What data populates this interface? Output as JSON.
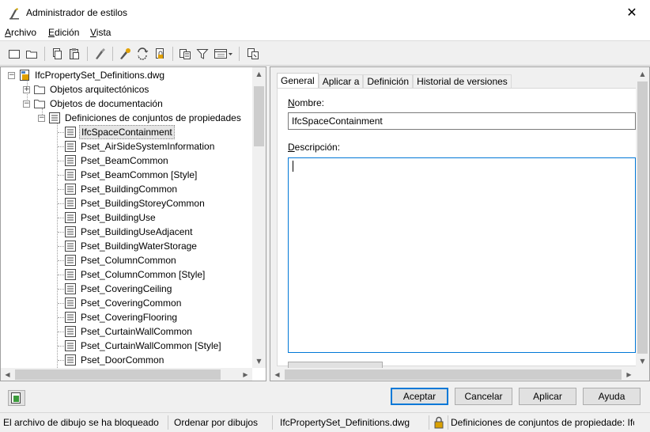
{
  "window": {
    "title": "Administrador de estilos",
    "close_glyph": "✕"
  },
  "menu": [
    {
      "label": "Archivo"
    },
    {
      "label": "Edición"
    },
    {
      "label": "Vista"
    }
  ],
  "toolbar": {
    "buttons": [
      "new-icon",
      "open-icon",
      "copy-icon",
      "paste-icon",
      "purge-icon",
      "edit-style-icon",
      "sync-icon",
      "lock-icon",
      "view-icon",
      "filter-icon",
      "display-icon",
      "help-icon"
    ]
  },
  "tree": {
    "root": "IfcPropertySet_Definitions.dwg",
    "folder1": "Objetos arquitectónicos",
    "folder2": "Objetos de documentación",
    "category": "Definiciones de conjuntos de propiedades",
    "items": [
      "IfcSpaceContainment",
      "Pset_AirSideSystemInformation",
      "Pset_BeamCommon",
      "Pset_BeamCommon [Style]",
      "Pset_BuildingCommon",
      "Pset_BuildingStoreyCommon",
      "Pset_BuildingUse",
      "Pset_BuildingUseAdjacent",
      "Pset_BuildingWaterStorage",
      "Pset_ColumnCommon",
      "Pset_ColumnCommon [Style]",
      "Pset_CoveringCeiling",
      "Pset_CoveringCommon",
      "Pset_CoveringFlooring",
      "Pset_CurtainWallCommon",
      "Pset_CurtainWallCommon [Style]",
      "Pset_DoorCommon"
    ],
    "expanded_glyph": "−",
    "collapsed_glyph": "+"
  },
  "tabs": [
    {
      "label": "General"
    },
    {
      "label": "Aplicar a"
    },
    {
      "label": "Definición"
    },
    {
      "label": "Historial de versiones"
    }
  ],
  "general": {
    "name_label": "Nombre:",
    "name_value": "IfcSpaceContainment",
    "desc_label": "Descripción:",
    "desc_value": ""
  },
  "buttons": {
    "accept": "Aceptar",
    "cancel": "Cancelar",
    "apply": "Aplicar",
    "help": "Ayuda"
  },
  "status": {
    "lock_msg": "El archivo de dibujo se ha bloqueado",
    "sort": "Ordenar por dibujos",
    "file": "IfcPropertySet_Definitions.dwg",
    "path": "Definiciones de conjuntos de propiedade: IfcSpaceContainment"
  },
  "arrows": {
    "up": "▲",
    "down": "▼",
    "left": "◀",
    "right": "▶"
  }
}
